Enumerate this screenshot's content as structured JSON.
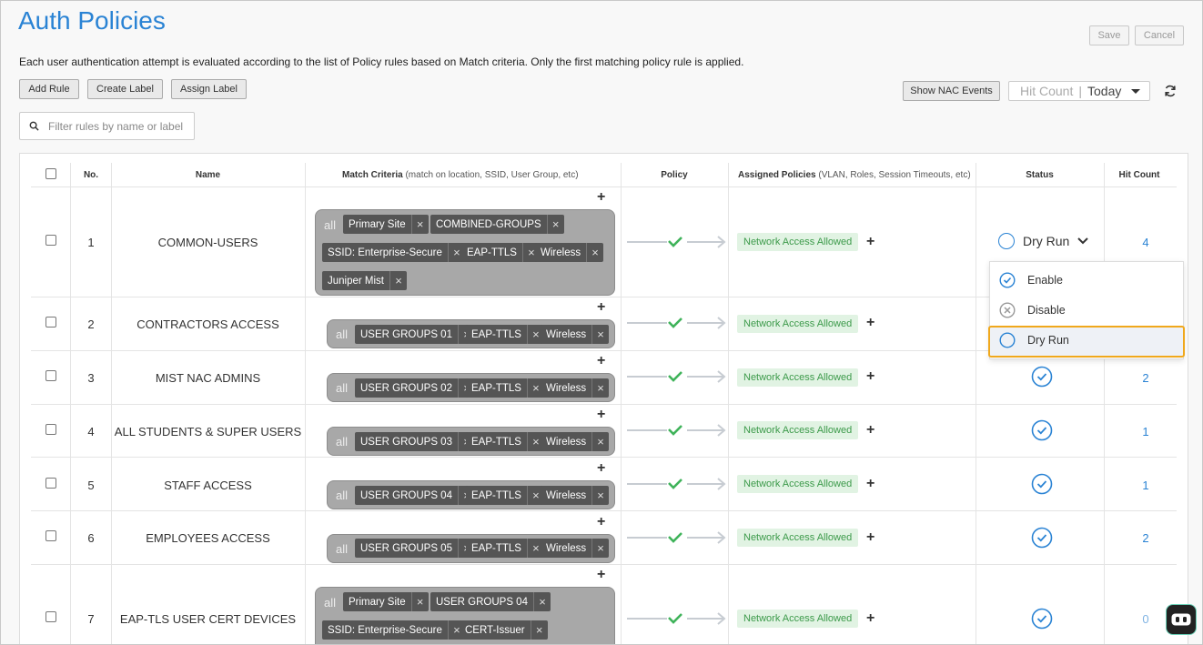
{
  "page": {
    "title": "Auth Policies",
    "description": "Each user authentication attempt is evaluated according to the list of Policy rules based on Match criteria. Only the first matching policy rule is applied."
  },
  "header_buttons": {
    "save": "Save",
    "cancel": "Cancel"
  },
  "toolbar": {
    "add_rule": "Add Rule",
    "create_label": "Create Label",
    "assign_label": "Assign Label",
    "show_nac_events": "Show NAC Events",
    "hit_count_label": "Hit Count",
    "hit_count_separator": "|",
    "hit_count_value": "Today"
  },
  "search": {
    "placeholder": "Filter rules by name or label"
  },
  "table": {
    "columns": {
      "no": "No.",
      "name": "Name",
      "match_criteria": "Match Criteria",
      "match_criteria_sub": "(match on location, SSID, User Group, etc)",
      "policy": "Policy",
      "assigned_policies": "Assigned Policies",
      "assigned_policies_sub": "(VLAN, Roles, Session Timeouts, etc)",
      "status": "Status",
      "hit_count": "Hit Count"
    },
    "rows": [
      {
        "no": "1",
        "name": "COMMON-USERS",
        "all": "all",
        "tags": [
          "Primary Site",
          "COMBINED-GROUPS",
          "SSID: Enterprise-Secure",
          "EAP-TTLS",
          "Wireless",
          "Juniper Mist"
        ],
        "assigned": "Network Access Allowed",
        "status": "Dry Run",
        "hit": "4"
      },
      {
        "no": "2",
        "name": "CONTRACTORS ACCESS",
        "all": "all",
        "tags": [
          "USER GROUPS 01",
          "EAP-TTLS",
          "Wireless"
        ],
        "assigned": "Network Access Allowed",
        "status": "enabled",
        "hit": ""
      },
      {
        "no": "3",
        "name": "MIST NAC ADMINS",
        "all": "all",
        "tags": [
          "USER GROUPS 02",
          "EAP-TTLS",
          "Wireless"
        ],
        "assigned": "Network Access Allowed",
        "status": "enabled",
        "hit": "2"
      },
      {
        "no": "4",
        "name": "ALL STUDENTS & SUPER USERS",
        "all": "all",
        "tags": [
          "USER GROUPS 03",
          "EAP-TTLS",
          "Wireless"
        ],
        "assigned": "Network Access Allowed",
        "status": "enabled",
        "hit": "1"
      },
      {
        "no": "5",
        "name": "STAFF ACCESS",
        "all": "all",
        "tags": [
          "USER GROUPS 04",
          "EAP-TTLS",
          "Wireless"
        ],
        "assigned": "Network Access Allowed",
        "status": "enabled",
        "hit": "1"
      },
      {
        "no": "6",
        "name": "EMPLOYEES ACCESS",
        "all": "all",
        "tags": [
          "USER GROUPS 05",
          "EAP-TTLS",
          "Wireless"
        ],
        "assigned": "Network Access Allowed",
        "status": "enabled",
        "hit": "2"
      },
      {
        "no": "7",
        "name": "EAP-TLS USER CERT DEVICES",
        "all": "all",
        "tags": [
          "Primary Site",
          "USER GROUPS 04",
          "SSID: Enterprise-Secure",
          "CERT-Issuer"
        ],
        "assigned": "Network Access Allowed",
        "status": "enabled",
        "hit": "0"
      }
    ]
  },
  "status_dropdown": {
    "items": [
      {
        "label": "Enable",
        "icon": "check-circle-icon"
      },
      {
        "label": "Disable",
        "icon": "x-circle-icon"
      },
      {
        "label": "Dry Run",
        "icon": "empty-circle-icon"
      }
    ],
    "selected": "Dry Run"
  },
  "colors": {
    "accent": "#2a83d4",
    "badge_bg": "#e1f3e3",
    "badge_text": "#3c9a4a",
    "check_green": "#3fb35a",
    "highlight_border": "#f0a81c"
  }
}
